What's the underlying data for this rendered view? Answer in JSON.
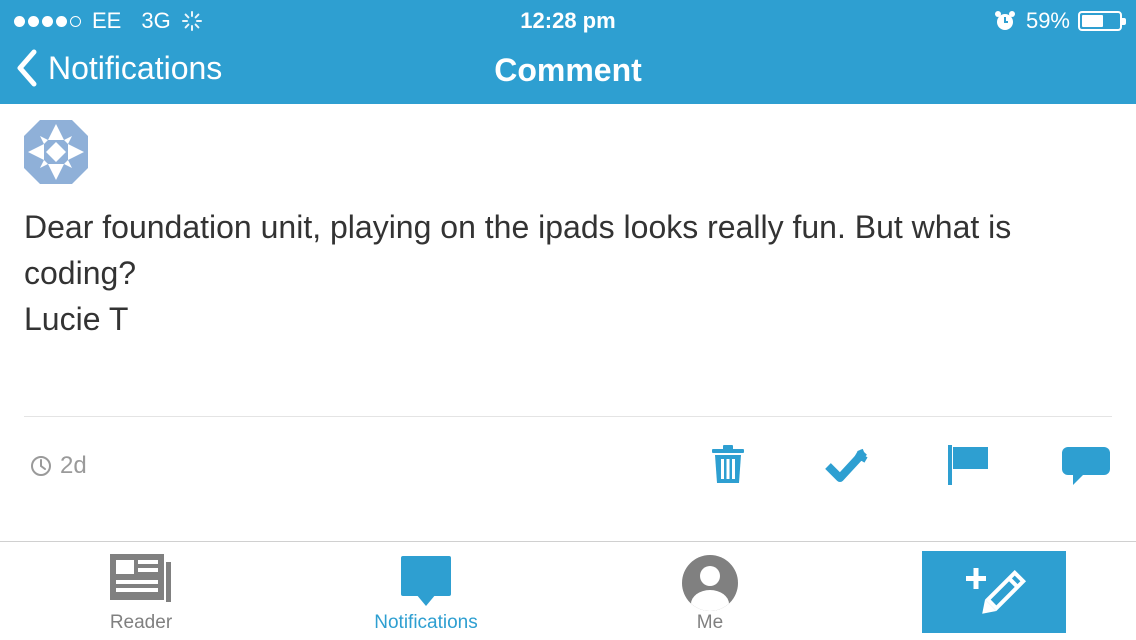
{
  "status_bar": {
    "carrier": "EE",
    "network": "3G",
    "time": "12:28 pm",
    "battery": "59%",
    "battery_level": 0.59
  },
  "nav": {
    "back_label": "Notifications",
    "title": "Comment"
  },
  "comment": {
    "lines": [
      "Dear foundation unit, playing on the ipads looks really fun. But what is coding?",
      "Lucie T"
    ],
    "age": "2d"
  },
  "tabs": {
    "reader": "Reader",
    "notifications": "Notifications",
    "me": "Me"
  },
  "colors": {
    "accent": "#2e9fd1",
    "muted": "#9a9a9a",
    "text": "#333333"
  },
  "icons": {
    "actions": [
      "trash-icon",
      "approve-icon",
      "flag-icon",
      "reply-icon"
    ],
    "tabs": [
      "reader-icon",
      "notifications-icon",
      "me-icon",
      "write-icon"
    ]
  }
}
